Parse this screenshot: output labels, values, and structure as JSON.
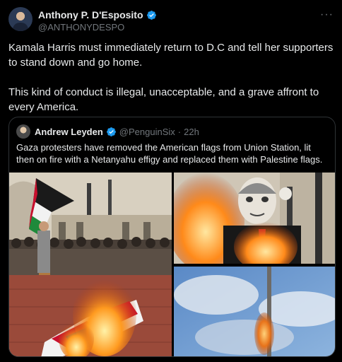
{
  "tweet": {
    "author_name": "Anthony P. D'Esposito",
    "author_handle": "@ANTHONYDESPO",
    "more_icon": "ellipsis-icon",
    "paragraph1": "Kamala Harris must immediately return to D.C and tell her supporters to stand down and go home.",
    "paragraph2": "This kind of conduct is illegal, unacceptable, and a grave affront to every America."
  },
  "quote": {
    "author_name": "Andrew Leyden",
    "author_handle": "@PenguinSix",
    "separator": "·",
    "time": "22h",
    "text": "Gaza protesters have removed the American flags from Union Station, lit then on fire with a Netanyahu effigy and replaced them with Palestine flags."
  },
  "colors": {
    "background": "#000000",
    "text": "#e7e9ea",
    "muted": "#71767b",
    "verified": "#1d9bf0",
    "border": "#2f3336"
  }
}
